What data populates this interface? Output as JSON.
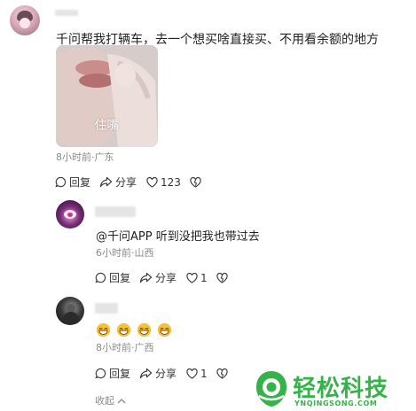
{
  "comments": [
    {
      "text": "千问帮我打辆车，去一个想买啥直接买、不用看余额的地方",
      "image_caption": "住嘴",
      "meta": "8小时前·广东",
      "reply_label": "回复",
      "share_label": "分享",
      "like_count": "123"
    },
    {
      "text": "@千问APP  听到没把我也带过去",
      "meta": "6小时前·山西",
      "reply_label": "回复",
      "share_label": "分享",
      "like_count": "1"
    },
    {
      "meta": "8小时前·广西",
      "reply_label": "回复",
      "share_label": "分享",
      "like_count": "1"
    }
  ],
  "collapse_label": "收起",
  "watermark": {
    "text": "轻松科技",
    "url": "YNQINGSONG.COM"
  },
  "colors": {
    "accent_green": "#35b24a",
    "meta_gray": "#8a8a8a"
  }
}
